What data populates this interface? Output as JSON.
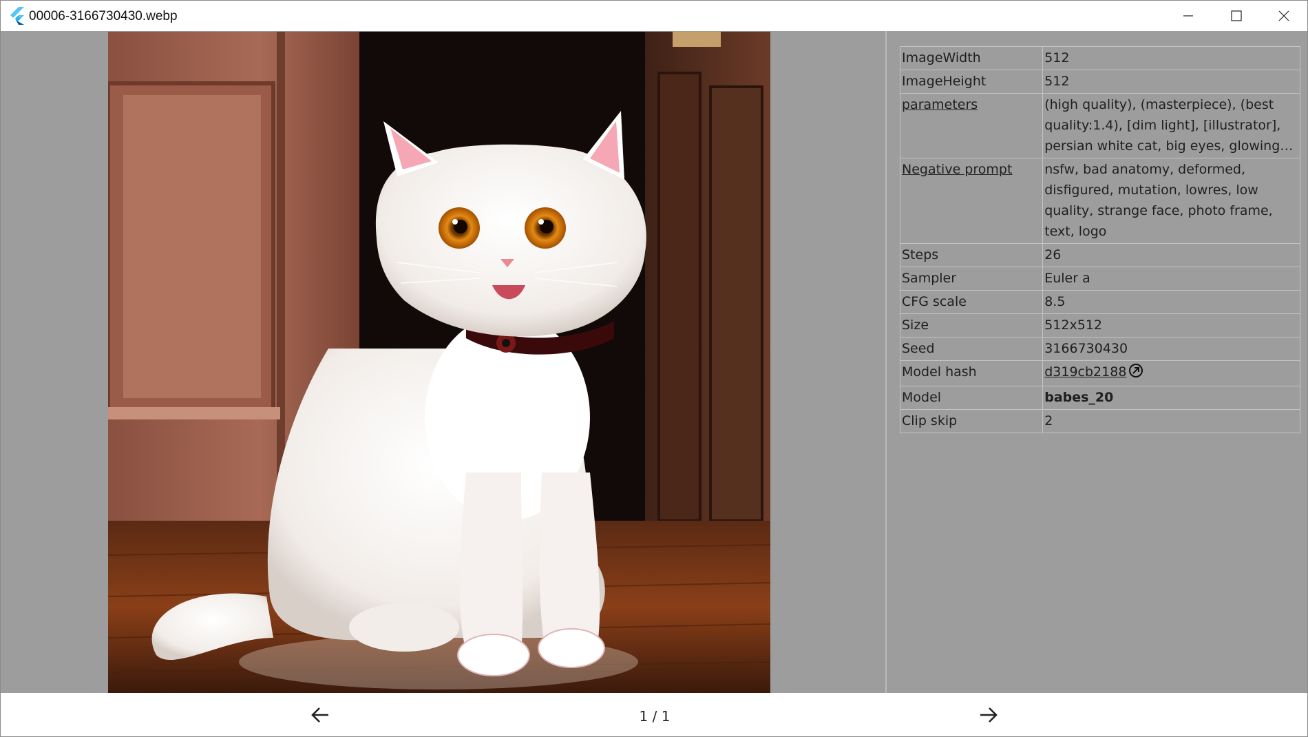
{
  "window": {
    "title": "00006-3166730430.webp"
  },
  "metadata": {
    "rows": [
      {
        "key": "ImageWidth",
        "value": "512"
      },
      {
        "key": "ImageHeight",
        "value": "512"
      },
      {
        "key": "parameters",
        "value": "(high quality), (masterpiece), (best quality:1.4), [dim light], [illustrator], persian white cat, big eyes, glowing…"
      },
      {
        "key": "Negative prompt",
        "value": "nsfw, bad anatomy, deformed, disfigured, mutation, lowres, low quality, strange face, photo frame, text, logo"
      },
      {
        "key": "Steps",
        "value": "26"
      },
      {
        "key": "Sampler",
        "value": "Euler a"
      },
      {
        "key": "CFG scale",
        "value": "8.5"
      },
      {
        "key": "Size",
        "value": "512x512"
      },
      {
        "key": "Seed",
        "value": "3166730430"
      },
      {
        "key": "Model hash",
        "value": "d319cb2188"
      },
      {
        "key": "Model",
        "value": "babes_20"
      },
      {
        "key": "Clip skip",
        "value": "2"
      }
    ]
  },
  "nav": {
    "page_indicator": "1 / 1"
  },
  "icons": {
    "app": "flutter-logo-icon",
    "minimize": "minimize-icon",
    "maximize": "maximize-icon",
    "close": "close-icon",
    "external_link": "external-link-icon",
    "prev": "arrow-left-icon",
    "next": "arrow-right-icon"
  },
  "colors": {
    "viewer_background": "#9d9d9d",
    "title_bar": "#ffffff",
    "table_border": "#c3c3c3",
    "app_icon": "#1e88e5"
  }
}
